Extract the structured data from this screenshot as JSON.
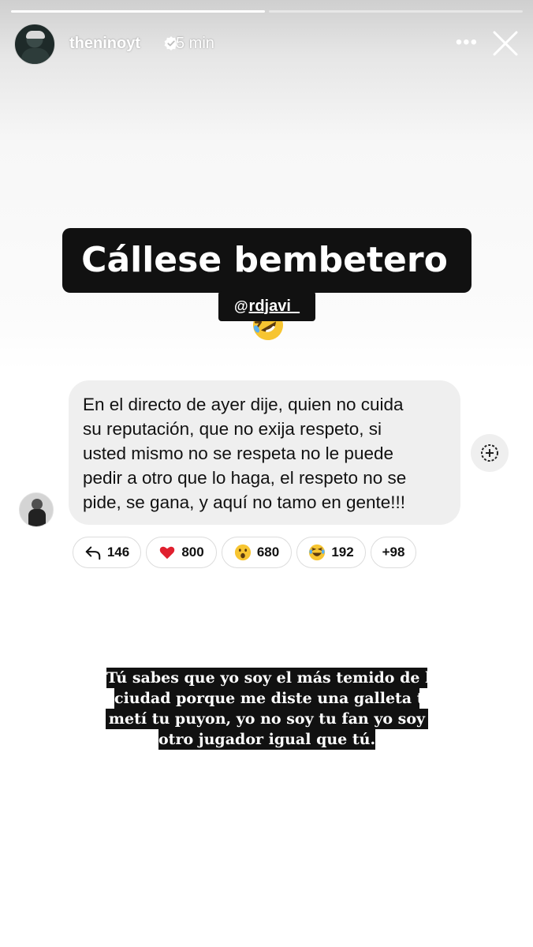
{
  "story": {
    "username": "theninoyt",
    "time": "5 min",
    "caption": "Cállese bembetero",
    "caption_emoji": "rolling-on-floor-laughing-emoji",
    "mention": "rdjavi_",
    "more_label": "•••"
  },
  "shared_post": {
    "message_lines": [
      "En el directo de ayer dije, quien no cuida",
      "su reputación, que no exija respeto, si",
      "usted mismo no se respeta no le puede",
      "pedir a otro que lo haga, el respeto no se",
      "pide, se gana, y aquí no tamo en gente!!!"
    ],
    "reactions": [
      {
        "icon": "reply-icon",
        "count": "146"
      },
      {
        "icon": "heart-icon",
        "count": "800"
      },
      {
        "icon": "surprised-emoji",
        "count": "680"
      },
      {
        "icon": "laughing-emoji",
        "count": "192"
      },
      {
        "icon": "",
        "count": "+98"
      }
    ]
  },
  "caption2_lines": [
    "Tú sabes que yo soy el más temido de la",
    "ciudad porque me diste una galleta te",
    "metí tu puyon, yo no soy tu fan yo soy",
    "otro jugador igual que tú."
  ],
  "colors": {
    "caption_bg": "#111111",
    "bubble_bg": "#efefef",
    "heart": "#e0202f"
  }
}
